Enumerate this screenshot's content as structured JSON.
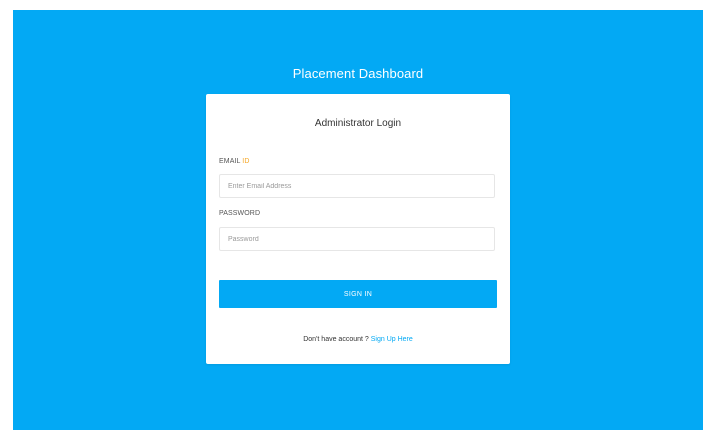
{
  "app": {
    "title": "Placement Dashboard"
  },
  "login_card": {
    "title": "Administrator Login",
    "email_label_main": "EMAIL ",
    "email_label_accent": "ID",
    "email_placeholder": "Enter Email Address",
    "email_value": "",
    "password_label": "PASSWORD",
    "password_placeholder": "Password",
    "password_value": "",
    "signin_label": "SIGN IN",
    "signup_prompt": "Don't have account ? ",
    "signup_link": "Sign Up Here"
  },
  "colors": {
    "background": "#03a9f4",
    "card": "#ffffff",
    "accent": "#03a9f4",
    "label_accent": "#f5a623"
  }
}
